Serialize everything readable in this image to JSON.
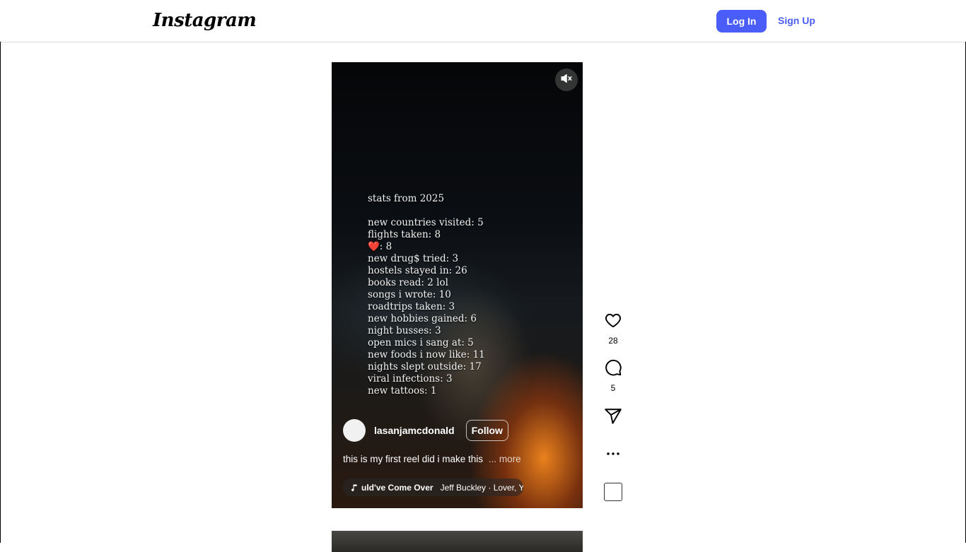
{
  "header": {
    "logo": "Instagram",
    "login_label": "Log In",
    "signup_label": "Sign Up"
  },
  "reel": {
    "overlay_lines": [
      "stats from 2025",
      "",
      "new countries visited: 5",
      "flights taken: 8",
      "❤️: 8",
      "new drug$ tried: 3",
      "hostels stayed in: 26",
      "books read: 2 lol",
      "songs i wrote: 10",
      "roadtrips taken: 3",
      "new hobbies gained: 6",
      "night busses: 3",
      "open mics i sang at: 5",
      "new foods i now like: 11",
      "nights slept outside: 17",
      "viral infections: 3",
      "new tattoos: 1"
    ],
    "author": "lasanjamcdonald",
    "follow_label": "Follow",
    "caption": "this is my first reel did i make this",
    "more_label": "... more",
    "music_song": "uld've Come Over",
    "music_artist": "Jeff Buckley · Lover, Yo"
  },
  "actions": {
    "likes": "28",
    "comments": "5"
  },
  "icons": [
    "instagram-logo",
    "mute-icon",
    "music-note-icon",
    "heart-icon",
    "comment-icon",
    "share-icon",
    "more-icon"
  ]
}
